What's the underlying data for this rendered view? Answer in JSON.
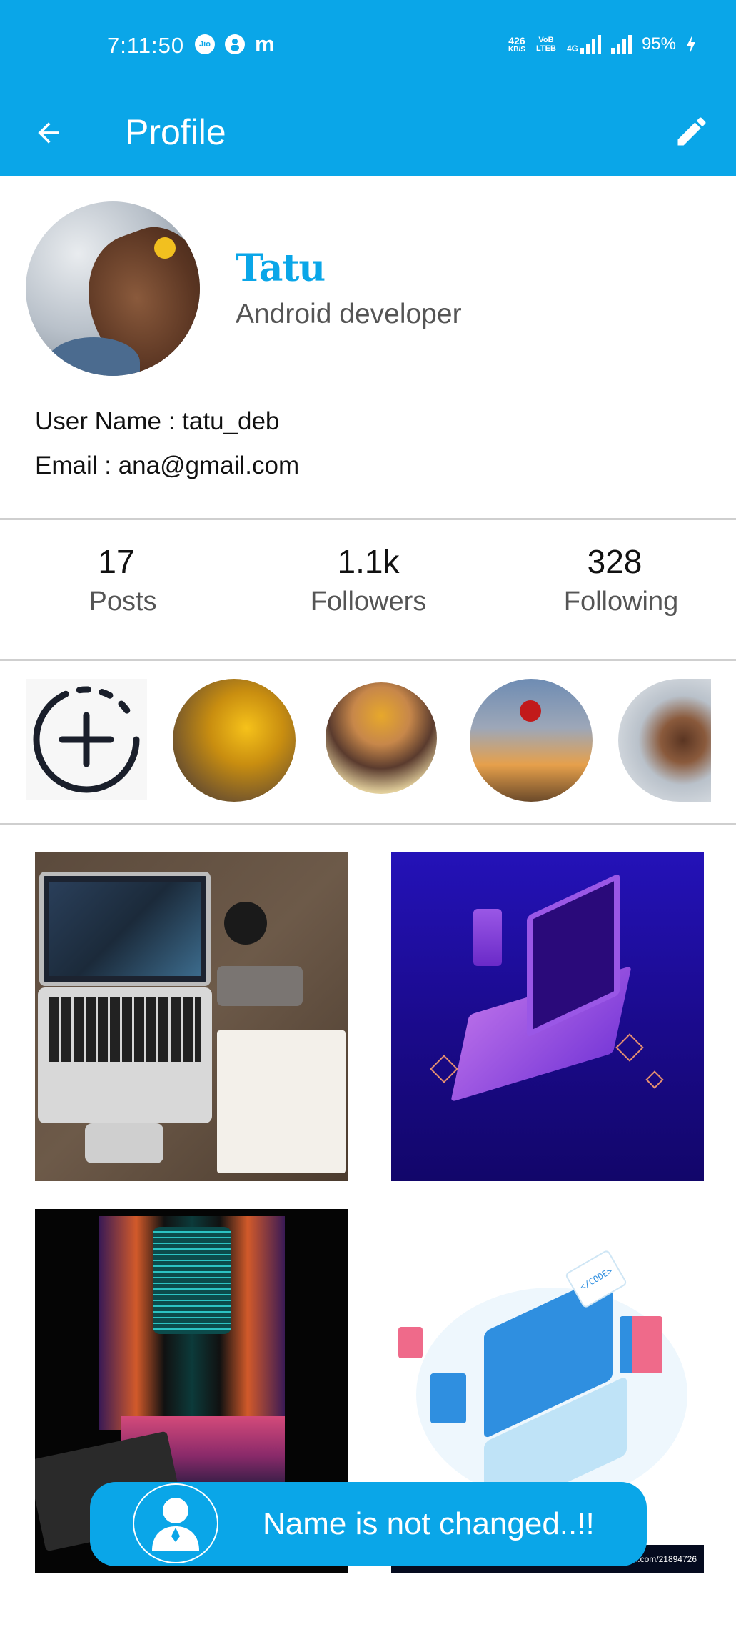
{
  "status_bar": {
    "time": "7:11:50",
    "left_icons": [
      "jio-icon",
      "person-icon",
      "m-icon"
    ],
    "jio_label": "Jio",
    "net_speed_value": "426",
    "net_speed_unit": "KB/S",
    "volte_label": "VoB LTEB",
    "network_label": "4G",
    "battery": "95%"
  },
  "app_bar": {
    "title": "Profile",
    "back_icon": "arrow-left-icon",
    "edit_icon": "pencil-icon",
    "color": "#0aa6e8"
  },
  "profile": {
    "name": "Tatu",
    "role": "Android developer",
    "username_line": "User Name : tatu_deb",
    "email_line": "Email : ana@gmail.com"
  },
  "stats": [
    {
      "value": "17",
      "label": "Posts"
    },
    {
      "value": "1.1k",
      "label": "Followers"
    },
    {
      "value": "328",
      "label": "Following"
    }
  ],
  "stories": {
    "add_icon": "add-circle-icon",
    "items": [
      "story-sunflowers-book",
      "story-sunflower-girl",
      "story-rose-sunset",
      "story-profile-photo"
    ]
  },
  "posts": [
    {
      "name": "post-laptop-desk"
    },
    {
      "name": "post-isometric-laptop"
    },
    {
      "name": "post-cyber-tunnel"
    },
    {
      "name": "post-laptop-illustration",
      "code_label": "</CODE>",
      "credit": "iStock.com/21894726"
    }
  ],
  "toast": {
    "message": "Name is not changed..!!",
    "icon": "user-avatar-icon"
  }
}
